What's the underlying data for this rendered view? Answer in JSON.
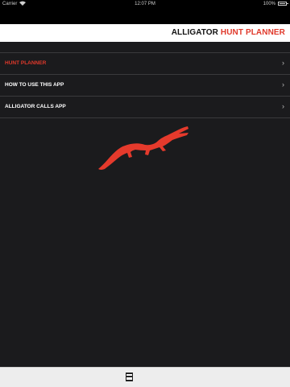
{
  "status_bar": {
    "carrier": "Carrier",
    "wifi_icon": "wifi-icon",
    "time": "12:07 PM",
    "battery": "100%",
    "battery_icon": "battery-icon"
  },
  "header": {
    "title_part1": "ALLIGATOR",
    "title_part2": "HUNT PLANNER"
  },
  "menu": {
    "items": [
      {
        "label": "HUNT PLANNER",
        "active": true
      },
      {
        "label": "HOW TO USE THIS APP",
        "active": false
      },
      {
        "label": "ALLIGATOR CALLS APP",
        "active": false
      }
    ]
  },
  "colors": {
    "accent": "#e0392b",
    "background": "#1b1b1d",
    "header_bg": "#ffffff"
  },
  "icons": {
    "logo": "alligator-silhouette",
    "bottom": "book-icon",
    "chevron": "chevron-right-icon"
  }
}
